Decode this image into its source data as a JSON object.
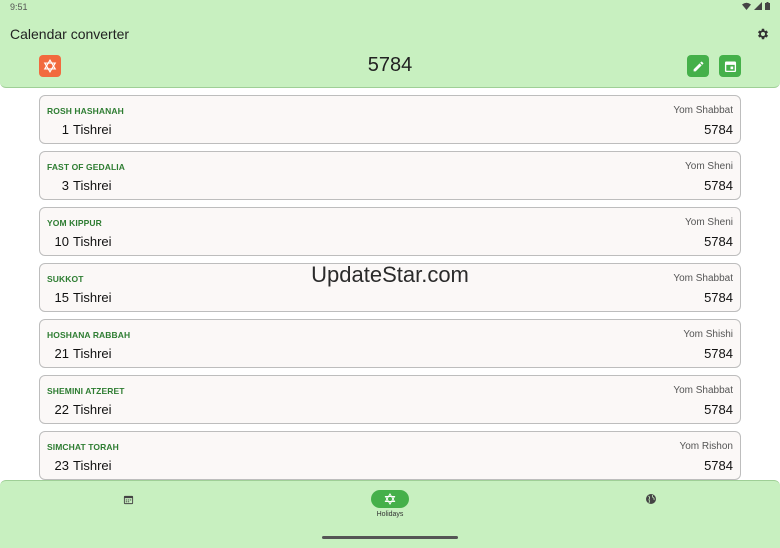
{
  "status": {
    "time": "9:51"
  },
  "app": {
    "title": "Calendar converter"
  },
  "header": {
    "year": "5784"
  },
  "holidays": [
    {
      "name": "ROSH HASHANAH",
      "day": "1",
      "month": "Tishrei",
      "weekday": "Yom Shabbat",
      "year": "5784"
    },
    {
      "name": "FAST OF GEDALIA",
      "day": "3",
      "month": "Tishrei",
      "weekday": "Yom Sheni",
      "year": "5784"
    },
    {
      "name": "YOM KIPPUR",
      "day": "10",
      "month": "Tishrei",
      "weekday": "Yom Sheni",
      "year": "5784"
    },
    {
      "name": "SUKKOT",
      "day": "15",
      "month": "Tishrei",
      "weekday": "Yom Shabbat",
      "year": "5784"
    },
    {
      "name": "HOSHANA RABBAH",
      "day": "21",
      "month": "Tishrei",
      "weekday": "Yom Shishi",
      "year": "5784"
    },
    {
      "name": "SHEMINI ATZERET",
      "day": "22",
      "month": "Tishrei",
      "weekday": "Yom Shabbat",
      "year": "5784"
    },
    {
      "name": "SIMCHAT TORAH",
      "day": "23",
      "month": "Tishrei",
      "weekday": "Yom Rishon",
      "year": "5784"
    }
  ],
  "watermark": "UpdateStar.com",
  "nav": {
    "holidays_label": "Holidays"
  },
  "colors": {
    "accent": "#45b04a",
    "bar": "#c8f0c0",
    "holiday_icon": "#f26a3e",
    "holiday_name": "#2e7d32"
  },
  "icons": [
    "gear-icon",
    "star-of-david-icon",
    "pencil-icon",
    "calendar-icon",
    "globe-icon"
  ]
}
